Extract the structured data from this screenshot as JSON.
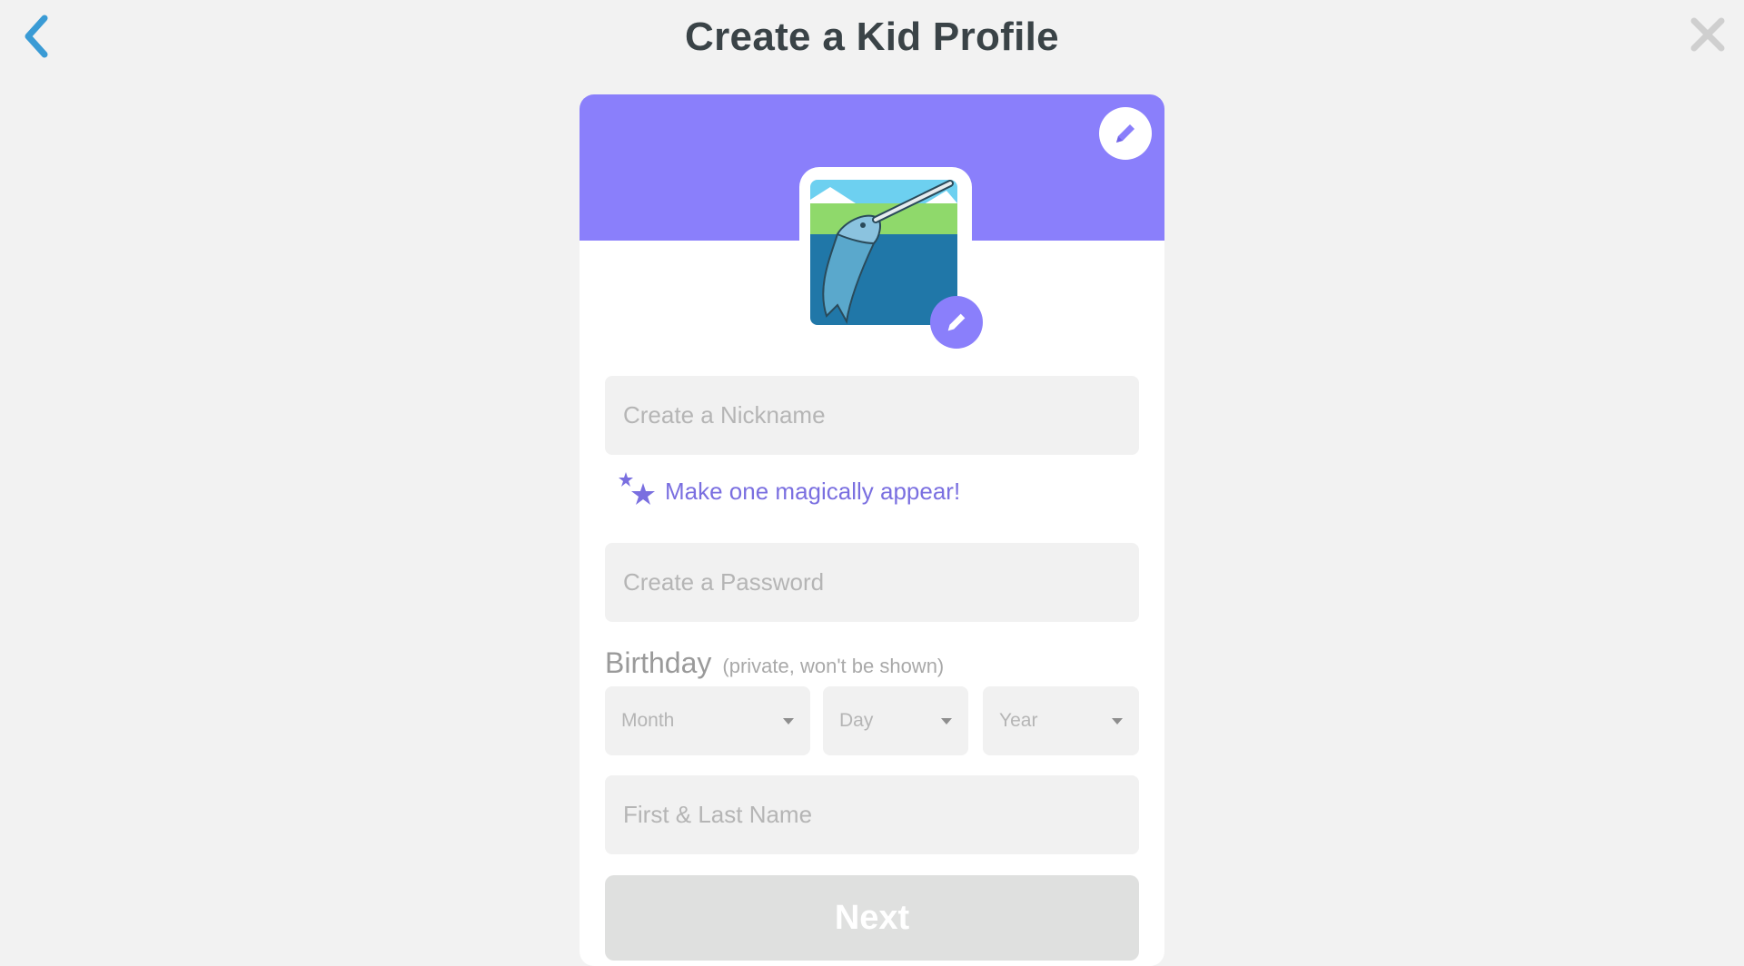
{
  "header": {
    "title": "Create a Kid Profile",
    "back_icon": "chevron-left-icon",
    "close_icon": "close-icon"
  },
  "profile": {
    "avatar": "narwhal-avatar",
    "banner_color": "#8a7ffb",
    "edit_icon": "pencil-icon"
  },
  "form": {
    "nickname_placeholder": "Create a Nickname",
    "magic_link": "Make one magically appear!",
    "password_placeholder": "Create a Password",
    "birthday_label": "Birthday",
    "birthday_note": "(private, won't be shown)",
    "month_placeholder": "Month",
    "day_placeholder": "Day",
    "year_placeholder": "Year",
    "name_placeholder": "First & Last Name",
    "next_label": "Next"
  },
  "colors": {
    "accent": "#8a7ffb",
    "back_arrow": "#3a9bd5",
    "title": "#3a4347",
    "link": "#7a6fe0"
  }
}
